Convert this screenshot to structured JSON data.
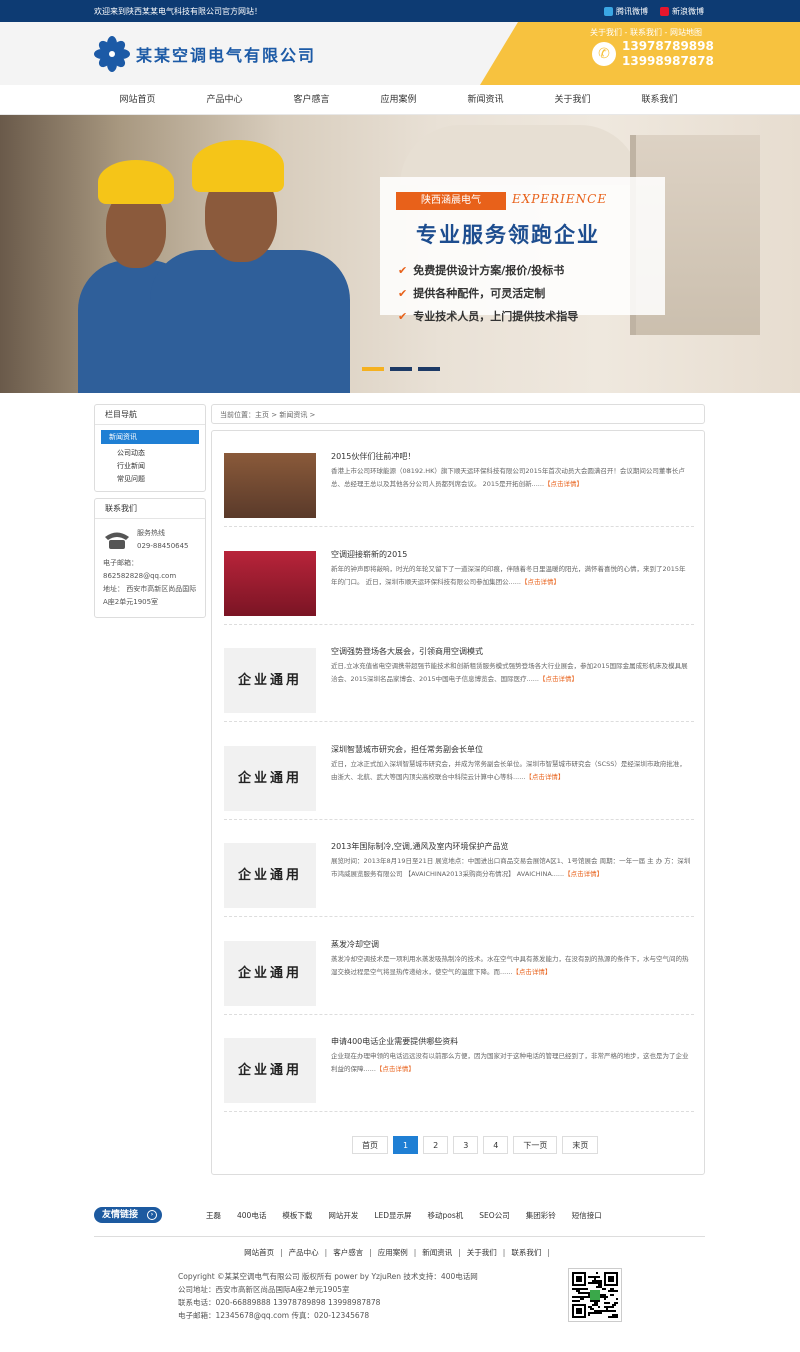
{
  "topbar": {
    "welcome": "欢迎来到陕西某某电气科技有限公司官方网站！",
    "tencent": "腾讯微博",
    "sina": "新浪微博"
  },
  "header": {
    "company": "某某空调电气有限公司",
    "links": "关于我们 - 联系我们 - 网站地图",
    "phone1": "13978789898",
    "phone2": "13998987878"
  },
  "nav": [
    "网站首页",
    "产品中心",
    "客户感言",
    "应用案例",
    "新闻资讯",
    "关于我们",
    "联系我们"
  ],
  "banner": {
    "tag": "陕西涵晨电气",
    "experience": "EXPERIENCE",
    "headline": "专业服务领跑企业",
    "points": [
      "免费提供设计方案/报价/投标书",
      "提供各种配件，可灵活定制",
      "专业技术人员，上门提供技术指导"
    ]
  },
  "sidebar": {
    "nav_title": "栏目导航",
    "active": "新闻资讯",
    "subs": [
      "公司动态",
      "行业新闻",
      "常见问题"
    ],
    "contact_title": "联系我们",
    "hotline_label": "服务热线",
    "hotline": "029-88450645",
    "email_label": "电子邮箱：",
    "email": "862582828@qq.com",
    "address": "地址：  西安市高新区尚品国际A座2单元1905室"
  },
  "crumb": "当前位置：主页 > 新闻资讯 >",
  "placeholder_text": "企业通用",
  "more_label": "【点击详情】",
  "news": [
    {
      "title": "2015伙伴们往前冲吧！",
      "desc": "香港上市公司环球能源（08192.HK）旗下顺天运环保科技有限公司2015年首次动员大会圆满召开！会议期间公司董事长卢总、总经理王总以及其他各分公司人员都列席会议。 2015是开拓创新......",
      "thumb": "photo1"
    },
    {
      "title": "空调迎接崭新的2015",
      "desc": "新年的钟声即将敲响，时光的年轮又留下了一道深深的印痕，伴随着冬日里温暖的阳光，满怀着喜悦的心情，来到了2015年年的门口。 近日，深圳市顺天运环保科技有限公司参加集团公......",
      "thumb": "photo2"
    },
    {
      "title": "空调强势登场各大展会，引领商用空调模式",
      "desc": "近日,立冰充值省电空调携带超强节能技术和创新租赁服务模式强势登场各大行业展会，参加2015国际金属成形机床及模具展洽会、2015深圳名品家博会、2015中国电子信息博览会、国际医疗......",
      "thumb": "tpl"
    },
    {
      "title": "深圳智慧城市研究会，担任常务副会长单位",
      "desc": "近日，立冰正式加入深圳智慧城市研究会，并成为常务副会长单位。深圳市智慧城市研究会（SCSS）是经深圳市政府批准，由浙大、北航、武大等国内顶尖高校联合中科院云计算中心等科......",
      "thumb": "tpl"
    },
    {
      "title": "2013年国际制冷,空调,通风及室内环境保护产品览",
      "desc": "展览时间：2013年8月19日至21日 展览地点：中国进出口商品交易会展馆A区1、1号馆展会 周期：一年一届 主 办 方：深圳市鸿威展览服务有限公司 【AVAICHINA2013采购商分布情况】 AVAICHINA......",
      "thumb": "tpl"
    },
    {
      "title": "蒸发冷却空调",
      "desc": "蒸发冷却空调技术是一项利用水蒸发吸热制冷的技术。水在空气中具有蒸发能力，在没有别的热源的条件下，水与空气间的热湿交换过程是空气将显热传递给水，使空气的温度下降。而......",
      "thumb": "tpl"
    },
    {
      "title": "申请400电话企业需要提供哪些资料",
      "desc": "企业现在办理申领的电话远远没有以前那么方便，因为国家对于这种电话的管理已经到了，非常严格的地步，这也是为了企业利益的保障......",
      "thumb": "tpl"
    }
  ],
  "pager": [
    "首页",
    "1",
    "2",
    "3",
    "4",
    "下一页",
    "末页"
  ],
  "friends": {
    "label": "友情链接",
    "links": [
      "王磊",
      "400电话",
      "模板下载",
      "网站开发",
      "LED显示屏",
      "移动pos机",
      "SEO公司",
      "集团彩铃",
      "短信接口"
    ]
  },
  "footnav": [
    "网站首页",
    "产品中心",
    "客户感言",
    "应用案例",
    "新闻资讯",
    "关于我们",
    "联系我们"
  ],
  "copyright": [
    "Copyright ©某某空调电气有限公司 版权所有 power by YzjuRen   技术支持：400电话网",
    "公司地址：西安市高新区尚品国际A座2单元1905室",
    "联系电话：020-66889888   13978789898   13998987878",
    "电子邮箱：12345678@qq.com        传真：020-12345678"
  ],
  "colors": {
    "topbar": "#0d3b73",
    "accent": "#f7c23f",
    "orange": "#e8611a",
    "blue": "#1f7fd4"
  }
}
